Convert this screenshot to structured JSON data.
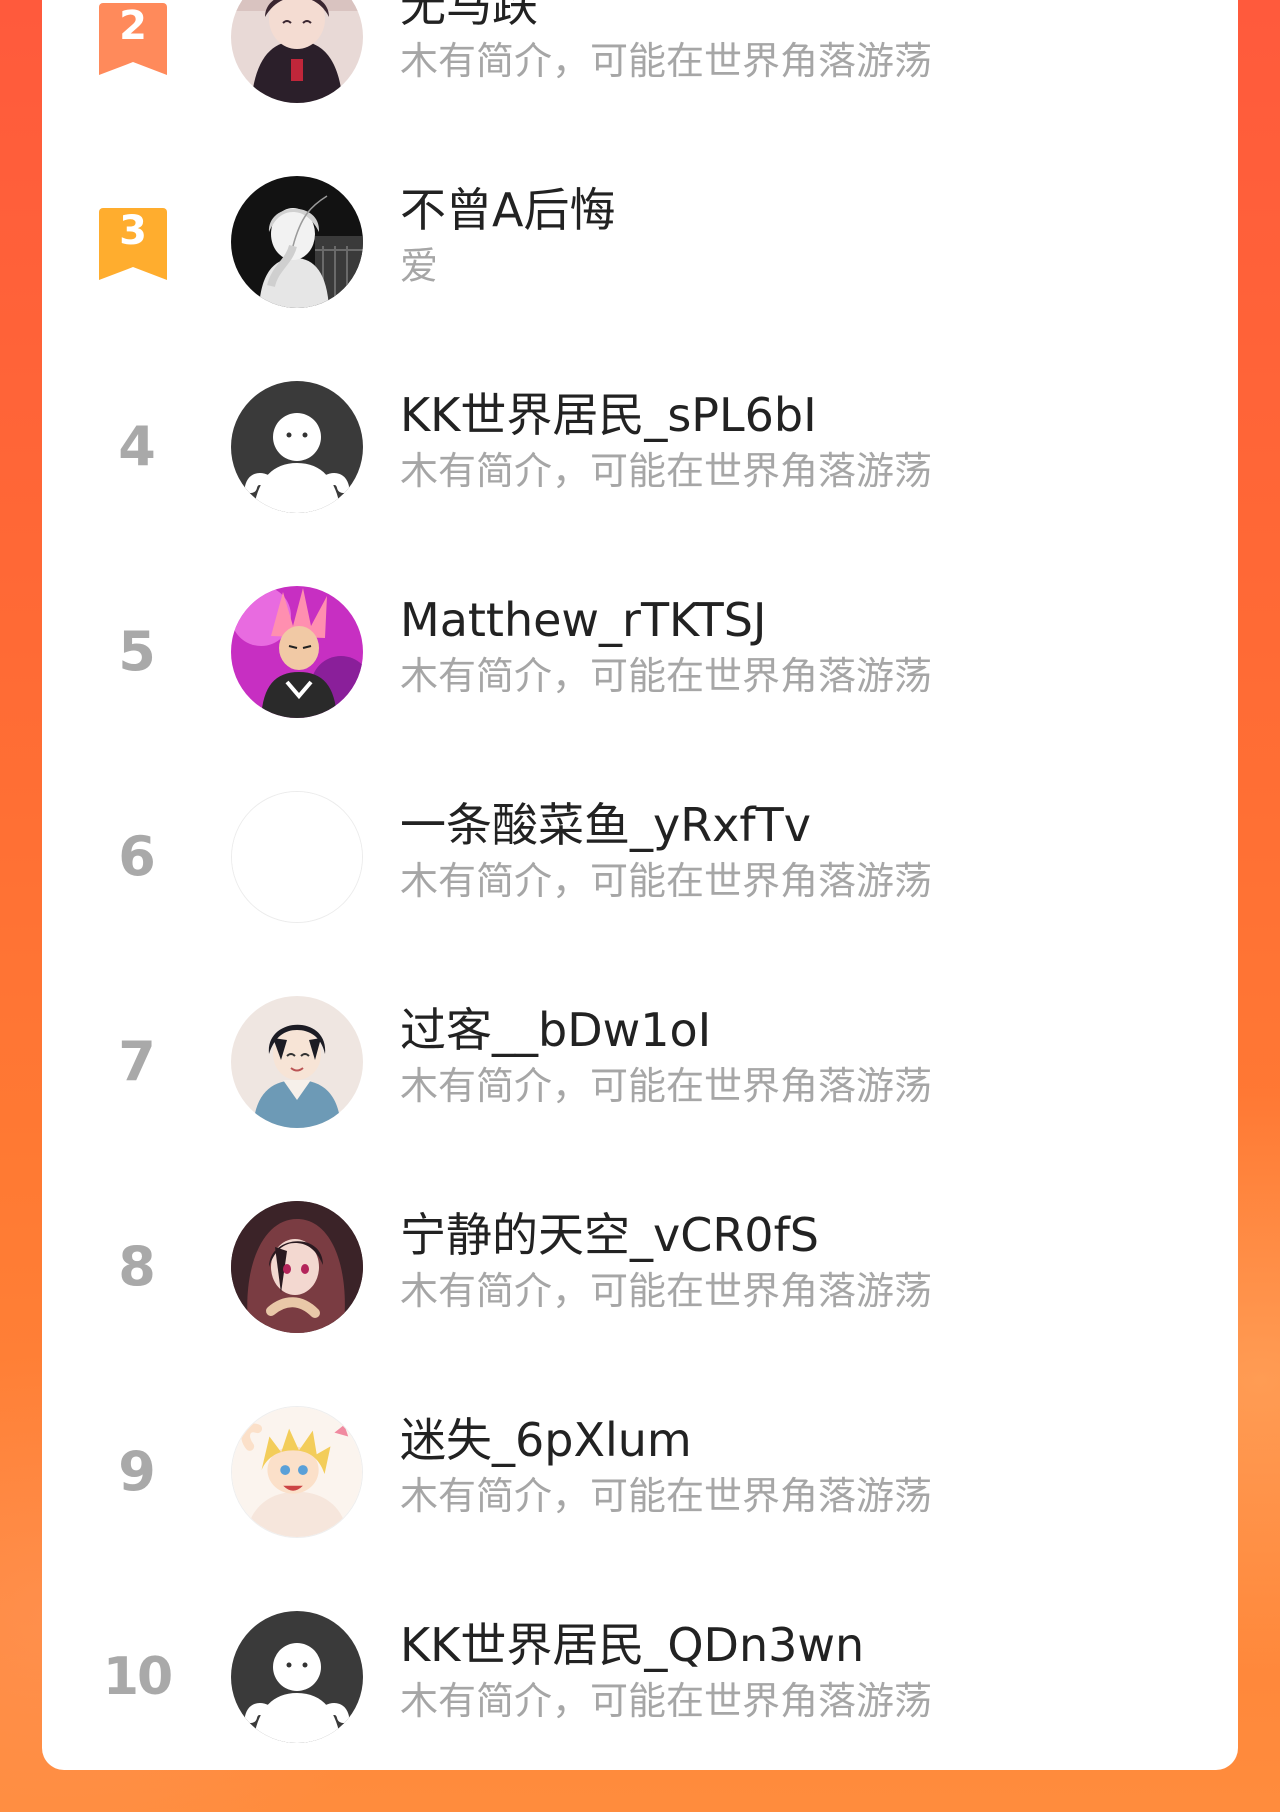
{
  "leaderboard": {
    "entries": [
      {
        "rank": "2",
        "name": "无马跌",
        "bio": "木有简介，可能在世界角落游荡",
        "avatar": "anime-girl-avatar",
        "badge": "ribbon",
        "badge_color": "#ff8a5b"
      },
      {
        "rank": "3",
        "name": "不曾A后悔",
        "bio": "爱",
        "avatar": "monochrome-boy-avatar",
        "badge": "ribbon",
        "badge_color": "#ffad2e"
      },
      {
        "rank": "4",
        "name": "KK世界居民_sPL6bI",
        "bio": "木有简介，可能在世界角落游荡",
        "avatar": "default-ghost-avatar"
      },
      {
        "rank": "5",
        "name": "Matthew_rTKTSJ",
        "bio": "木有简介，可能在世界角落游荡",
        "avatar": "anime-warrior-avatar"
      },
      {
        "rank": "6",
        "name": "一条酸菜鱼_yRxfTv",
        "bio": "木有简介，可能在世界角落游荡",
        "avatar": "blank-avatar"
      },
      {
        "rank": "7",
        "name": "过客__bDw1oI",
        "bio": "木有简介，可能在世界角落游荡",
        "avatar": "anime-hoodie-boy-avatar"
      },
      {
        "rank": "8",
        "name": "宁静的天空_vCR0fS",
        "bio": "木有简介，可能在世界角落游荡",
        "avatar": "anime-hooded-girl-avatar"
      },
      {
        "rank": "9",
        "name": "迷失_6pXlum",
        "bio": "木有简介，可能在世界角落游荡",
        "avatar": "anime-blonde-boy-avatar"
      },
      {
        "rank": "10",
        "name": "KK世界居民_QDn3wn",
        "bio": "木有简介，可能在世界角落游荡",
        "avatar": "default-ghost-avatar"
      }
    ]
  },
  "colors": {
    "background_top": "#ff5a3c",
    "background_bottom": "#ff8c3d",
    "card": "#ffffff",
    "name_text": "#222222",
    "bio_text": "#a6a6a6",
    "rank_text": "#a9a9a9"
  }
}
